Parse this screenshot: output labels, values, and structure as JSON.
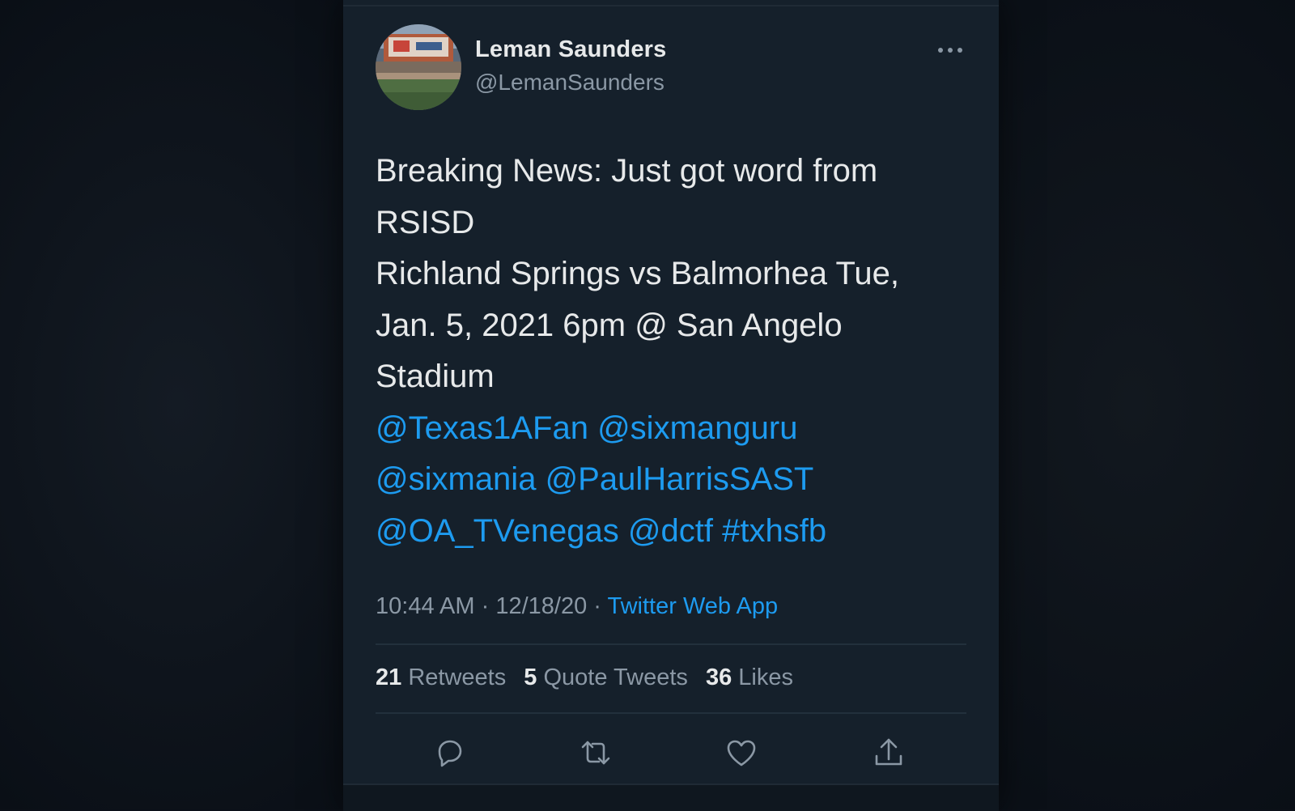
{
  "tweet": {
    "author_name": "Leman Saunders",
    "author_handle": "@LemanSaunders",
    "more_icon": "more-horizontal-icon",
    "avatar": "stadium-photo",
    "text_lines": [
      "Breaking News:  Just got word from",
      "RSISD",
      "Richland Springs vs Balmorhea Tue,",
      "Jan. 5, 2021 6pm @ San Angelo",
      "Stadium"
    ],
    "mention_lines": [
      [
        "@Texas1AFan",
        "@sixmanguru"
      ],
      [
        "@sixmania",
        "@PaulHarrisSAST"
      ],
      [
        "@OA_TVenegas",
        "@dctf",
        "#txhsfb"
      ]
    ],
    "time": "10:44 AM",
    "separator": "·",
    "date": "12/18/20",
    "source": "Twitter Web App",
    "stats": {
      "retweets_count": "21",
      "retweets_label": "Retweets",
      "quotes_count": "5",
      "quotes_label": "Quote Tweets",
      "likes_count": "36",
      "likes_label": "Likes"
    },
    "actions": [
      "reply-icon",
      "retweet-icon",
      "like-icon",
      "share-icon"
    ]
  },
  "colors": {
    "background": "#15202b",
    "primary_text": "#e7e9ea",
    "secondary_text": "#8b98a5",
    "link": "#1d9bf0"
  }
}
